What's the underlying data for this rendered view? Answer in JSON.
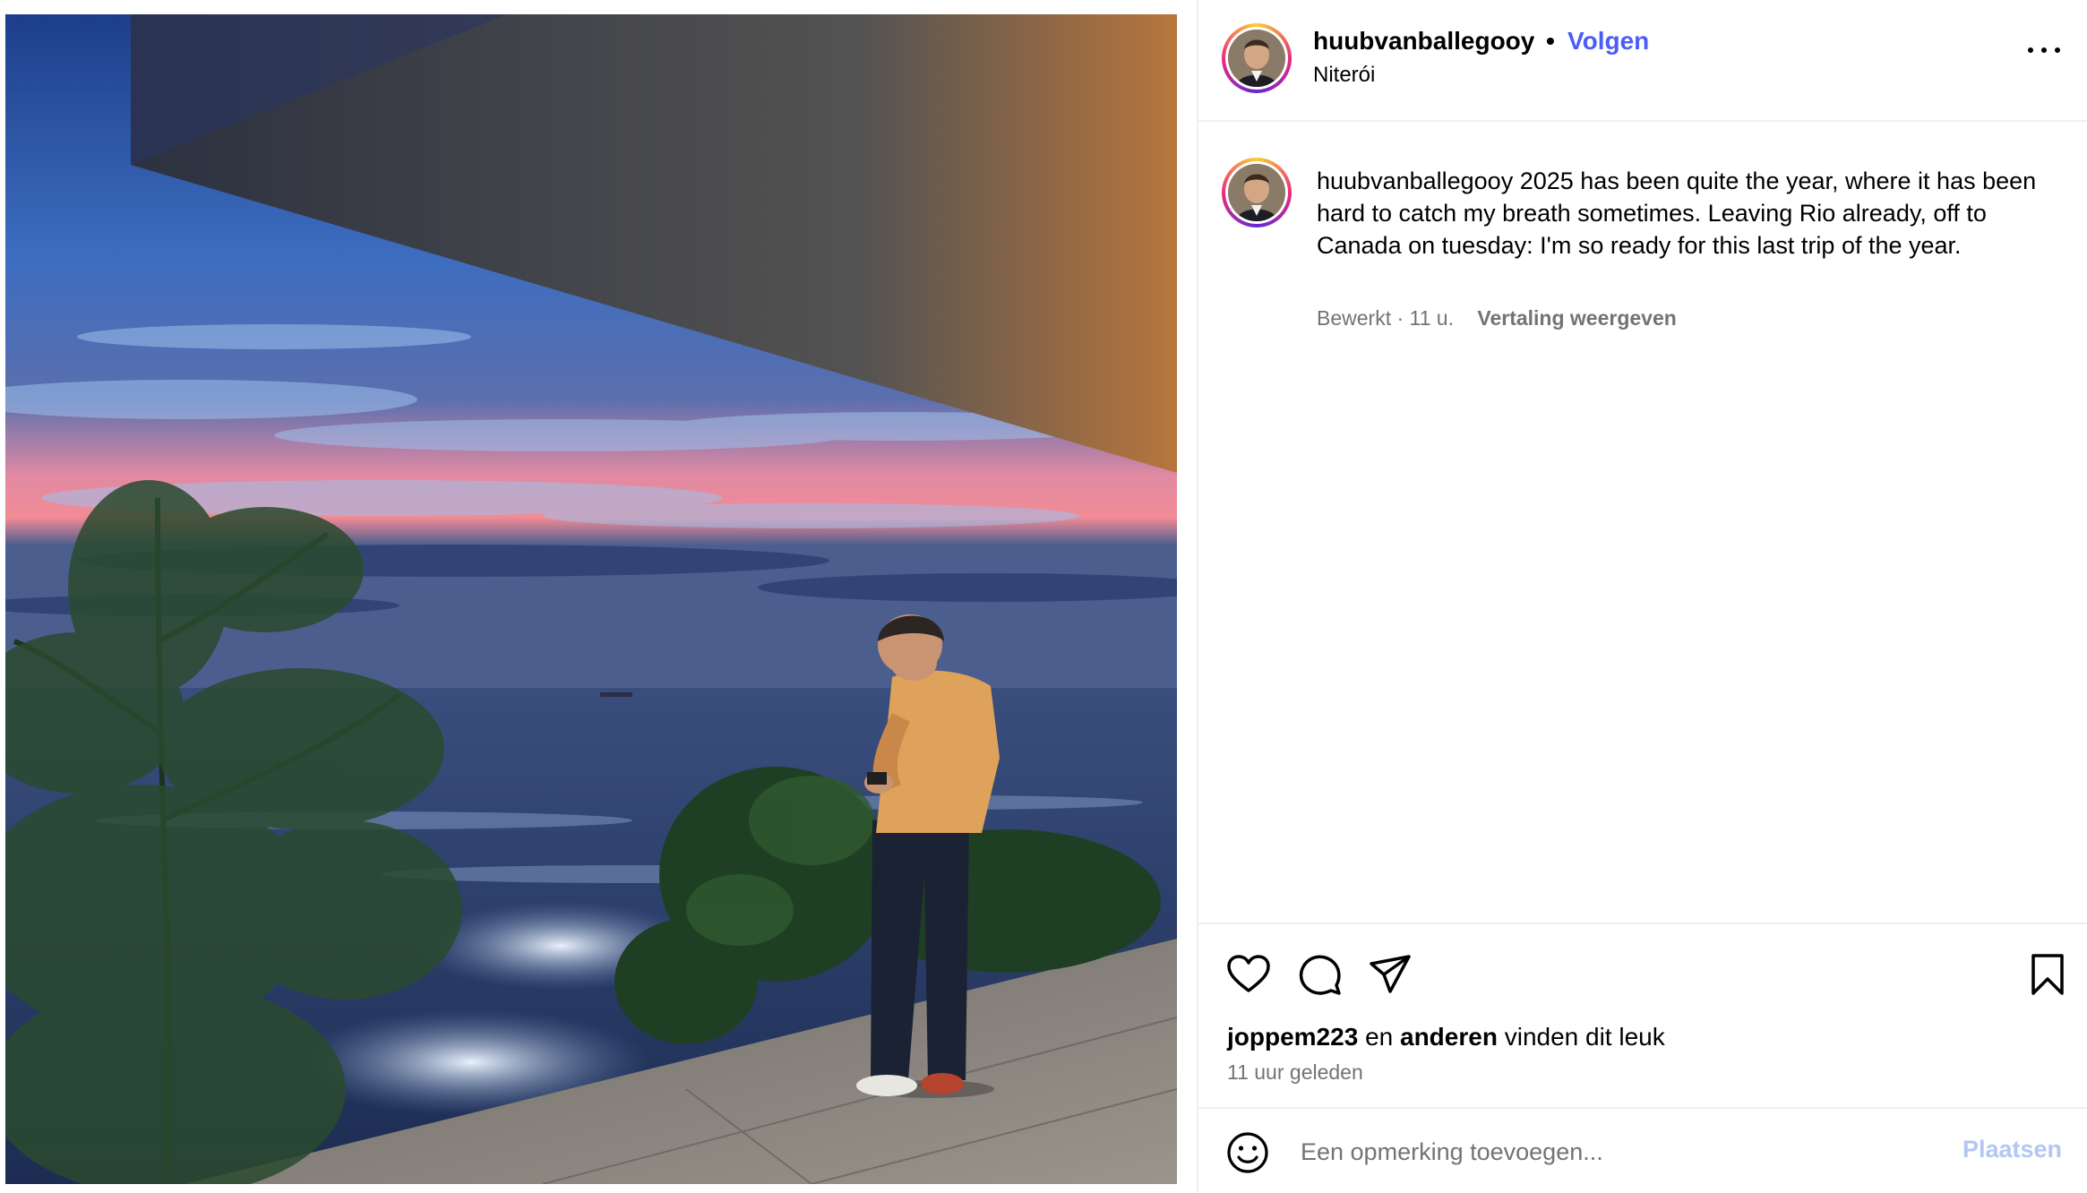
{
  "post": {
    "username": "huubvanballegooy",
    "separator": "•",
    "follow_label": "Volgen",
    "location": "Niterói",
    "caption_username": "huubvanballegooy",
    "caption": "2025 has been quite the year, where it has been hard to catch my breath sometimes. Leaving Rio already, off to Canada on tuesday: I'm so ready for this last trip of the year.",
    "caption_meta": "Bewerkt · 11 u.",
    "translate_label": "Vertaling weergeven"
  },
  "engagement": {
    "liker": "joppem223",
    "en": "en",
    "others": "anderen",
    "likes_suffix": "vinden dit leuk",
    "time_ago": "11 uur geleden"
  },
  "comment": {
    "placeholder": "Een opmerking toevoegen...",
    "post_label": "Plaatsen"
  },
  "icons": {
    "more": "more-options-icon",
    "like": "heart-icon",
    "comment": "comment-bubble-icon",
    "share": "paper-plane-icon",
    "save": "bookmark-icon",
    "emoji": "emoji-smile-icon"
  },
  "colors": {
    "follow": "#4a5df9",
    "post_disabled": "#b3c6f5",
    "secondary_text": "#737373",
    "divider": "#efefef"
  }
}
